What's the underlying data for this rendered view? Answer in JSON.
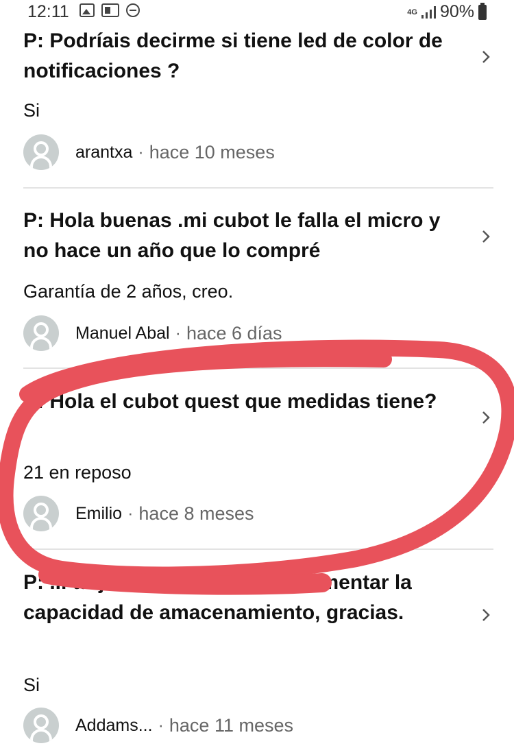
{
  "status_bar": {
    "time": "12:11",
    "network": "4G",
    "battery": "90%",
    "icons": [
      "picture-icon",
      "mail-icon",
      "do-not-disturb-icon",
      "signal-icon",
      "battery-icon"
    ]
  },
  "questions": [
    {
      "question": "P: Podríais decirme si tiene led de color de notificaciones ?",
      "answer": "Si",
      "author": "arantxa",
      "separator": "·",
      "time": "hace 10 meses"
    },
    {
      "question": "P: Hola buenas .mi cubot le falla el micro y no hace un año que lo compré",
      "answer": "Garantía de 2 años, creo.",
      "author": "Manuel Abal",
      "separator": "·",
      "time": "hace 6 días"
    },
    {
      "question": "P: Hola el cubot quest que medidas tiene?",
      "answer": "21 en reposo",
      "author": "Emilio",
      "separator": "·",
      "time": "hace 8 meses"
    },
    {
      "question": "P: ... tarjeta de 128gb? para aumentar la capacidad de amacenamiento, gracias.",
      "answer": "Si",
      "author": "Addams...",
      "separator": "·",
      "time": "hace 11 meses"
    }
  ],
  "annotation": {
    "shape": "hand-drawn-ellipse",
    "color": "#e8525b"
  }
}
